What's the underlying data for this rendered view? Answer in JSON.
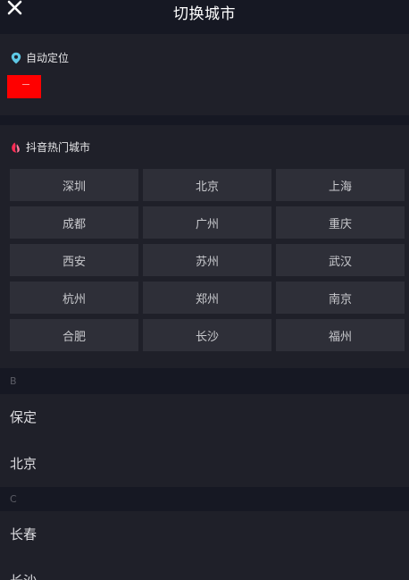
{
  "header": {
    "title": "切换城市",
    "close_icon": "close-icon"
  },
  "location": {
    "label": "自动定位",
    "icon": "location-pin-icon",
    "icon_color": "#5ec8e5"
  },
  "hot_cities": {
    "label": "抖音热门城市",
    "icon": "douyin-flame-icon",
    "icon_color": "#fe2c55",
    "cities": [
      "深圳",
      "北京",
      "上海",
      "成都",
      "广州",
      "重庆",
      "西安",
      "苏州",
      "武汉",
      "杭州",
      "郑州",
      "南京",
      "合肥",
      "长沙",
      "福州"
    ]
  },
  "groups": [
    {
      "letter": "B",
      "cities": [
        "保定",
        "北京"
      ]
    },
    {
      "letter": "C",
      "cities": [
        "长春",
        "长沙"
      ]
    }
  ],
  "colors": {
    "background": "#161823",
    "section_background": "#1f2029",
    "button_background": "#2e2f38",
    "redaction": "#ff0000"
  }
}
